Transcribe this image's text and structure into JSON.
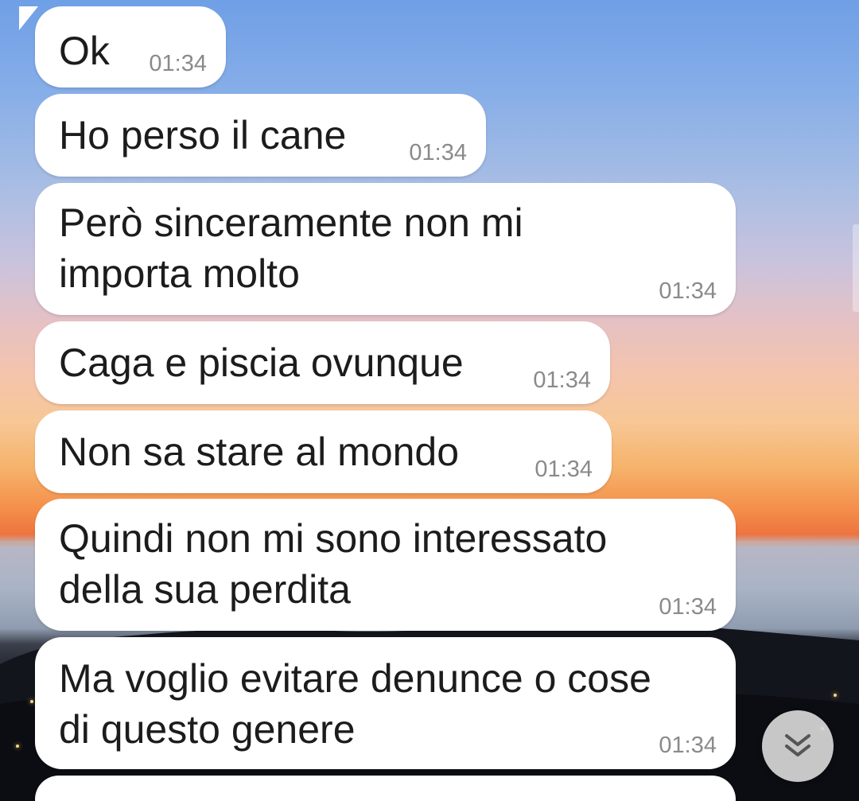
{
  "messages": [
    {
      "text": "Ok",
      "time": "01:34"
    },
    {
      "text": "Ho perso il cane",
      "time": "01:34"
    },
    {
      "text": "Però sinceramente non mi\nimporta molto",
      "time": "01:34"
    },
    {
      "text": "Caga e piscia ovunque",
      "time": "01:34"
    },
    {
      "text": "Non sa stare al mondo",
      "time": "01:34"
    },
    {
      "text": "Quindi non mi sono interessato\ndella sua perdita",
      "time": "01:34"
    },
    {
      "text": "Ma voglio evitare denunce o cose\ndi questo genere",
      "time": "01:34"
    }
  ],
  "scroll_down_button": {
    "icon": "double-chevron-down-icon"
  },
  "colors": {
    "bubble": "#ffffff",
    "text": "#1c1c1c",
    "timestamp": "#8a8a8a",
    "scroll_button": "#d6d6d6"
  }
}
